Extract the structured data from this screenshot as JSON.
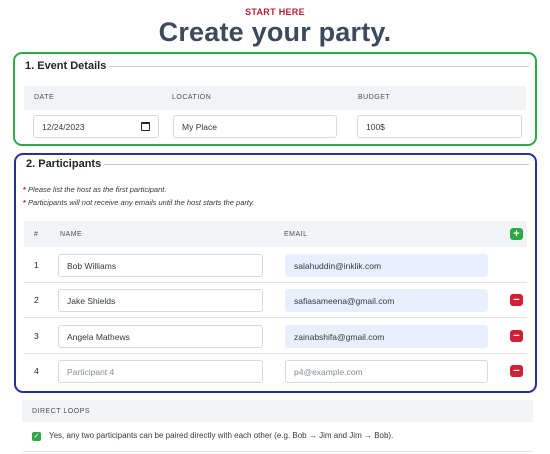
{
  "header": {
    "eyebrow": "START HERE",
    "title": "Create your party."
  },
  "event": {
    "legend": "1. Event Details",
    "columns": {
      "date": "DATE",
      "location": "LOCATION",
      "budget": "BUDGET"
    },
    "date_value": "12/24/2023",
    "location_value": "My Place",
    "budget_value": "100$"
  },
  "participants": {
    "legend": "2. Participants",
    "note1": "Please list the host as the first participant.",
    "note2": "Participants will not receive any emails until the host starts the party.",
    "columns": {
      "num": "#",
      "name": "NAME",
      "email": "EMAIL"
    },
    "add_label": "+",
    "remove_label": "−",
    "rows": [
      {
        "num": "1",
        "name": "Bob Williams",
        "email": "salahuddin@inklik.com"
      },
      {
        "num": "2",
        "name": "Jake Shields",
        "email": "safiasameena@gmail.com"
      },
      {
        "num": "3",
        "name": "Angela Mathews",
        "email": "zainabshifa@gmail.com"
      },
      {
        "num": "4",
        "name_placeholder": "Participant 4",
        "email_placeholder": "p4@example.com"
      }
    ]
  },
  "loops": {
    "header": "DIRECT LOOPS",
    "check_mark": "✓",
    "option": "Yes, any two participants can be paired directly with each other (e.g. Bob → Jim and Jim → Bob)."
  },
  "colors": {
    "event_border": "#2fa84a",
    "participants_border": "#2a2f95",
    "add": "#2fa84a",
    "remove": "#d11f36",
    "eyebrow": "#b8202f"
  }
}
